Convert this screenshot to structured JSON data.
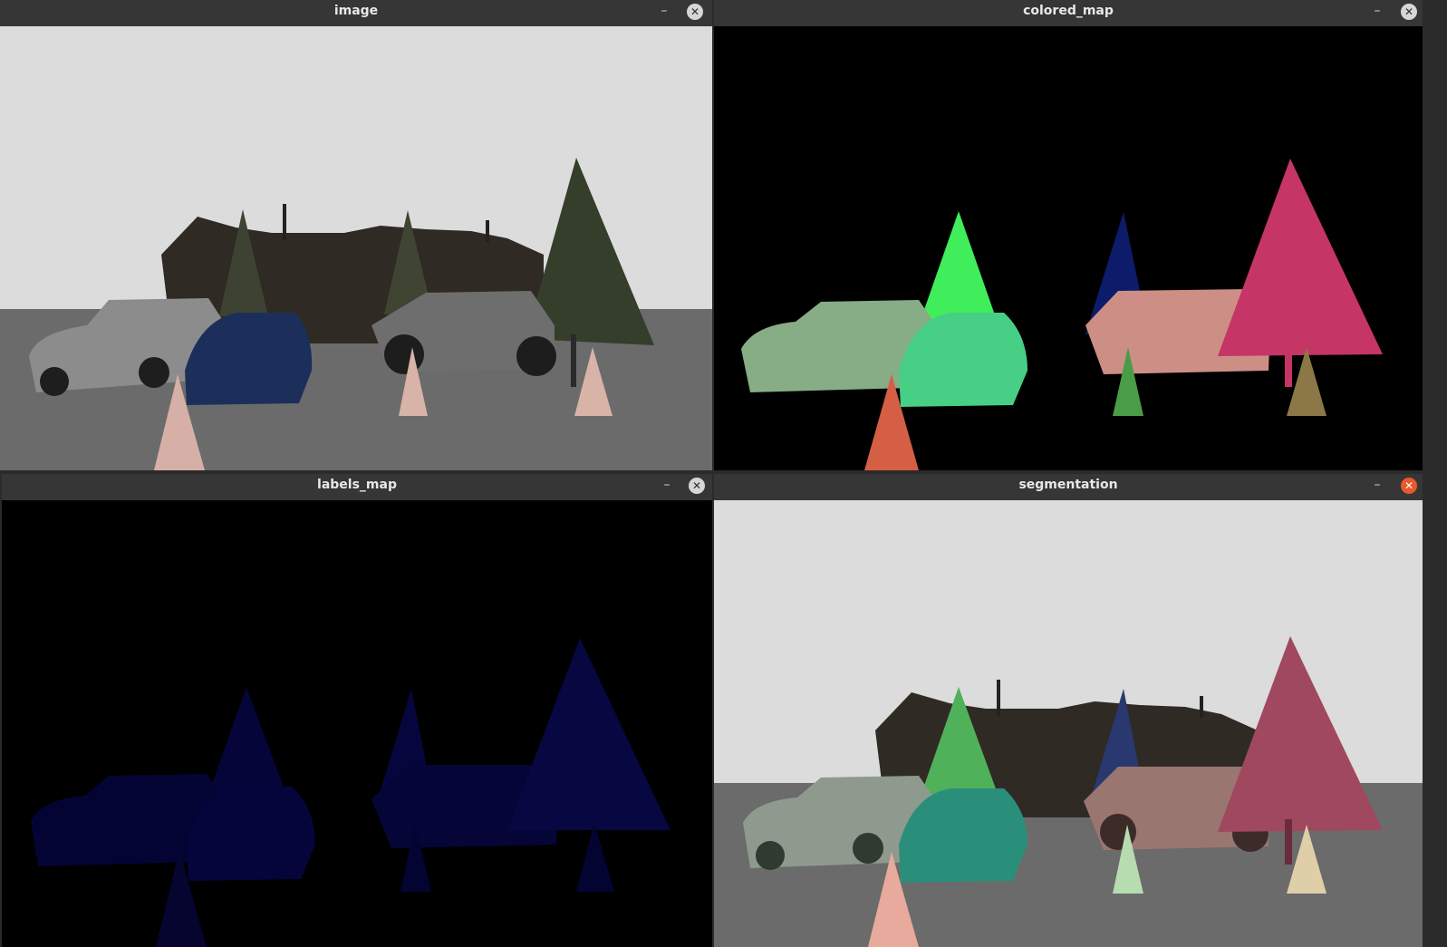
{
  "windows": {
    "image": {
      "title": "image"
    },
    "colored_map": {
      "title": "colored_map"
    },
    "labels_map": {
      "title": "labels_map"
    },
    "segmentation": {
      "title": "segmentation"
    }
  },
  "controls": {
    "minimize_glyph": "–",
    "close_glyph": "✕",
    "minimize_icon": "minimize-icon",
    "close_icon": "close-icon"
  },
  "colors": {
    "titlebar": "#363636",
    "close_active": "#e8592a",
    "sky": "#dcdcdc",
    "ground": "#6b6b6b",
    "background_map": "#000000"
  }
}
